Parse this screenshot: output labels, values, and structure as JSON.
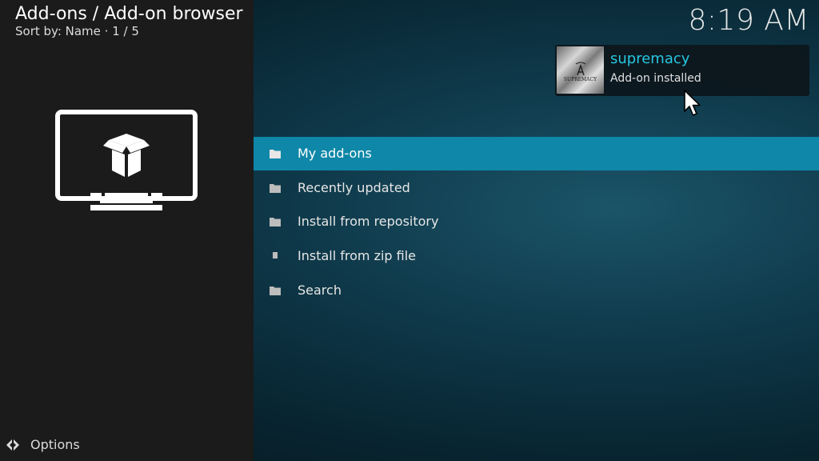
{
  "header": {
    "title": "Add-ons / Add-on browser",
    "sort": "Sort by: Name  ·  1 / 5"
  },
  "clock": "8:19 AM",
  "category": {
    "icon": "addon-box-monitor-icon"
  },
  "menu": {
    "items": [
      {
        "label": "My add-ons",
        "icon": "folder-icon",
        "focused": true
      },
      {
        "label": "Recently updated",
        "icon": "folder-icon",
        "focused": false
      },
      {
        "label": "Install from repository",
        "icon": "folder-icon",
        "focused": false
      },
      {
        "label": "Install from zip file",
        "icon": "file-icon",
        "focused": false
      },
      {
        "label": "Search",
        "icon": "folder-icon",
        "focused": false
      }
    ]
  },
  "notification": {
    "title": "supremacy",
    "message": "Add-on installed",
    "thumb_text": "SUPREMACY"
  },
  "footer": {
    "options_label": "Options",
    "icon": "options-arrows-icon"
  },
  "colors": {
    "focus": "#0f87a8",
    "notification_title": "#27c6e0",
    "left_panel": "#1b1b1b"
  }
}
